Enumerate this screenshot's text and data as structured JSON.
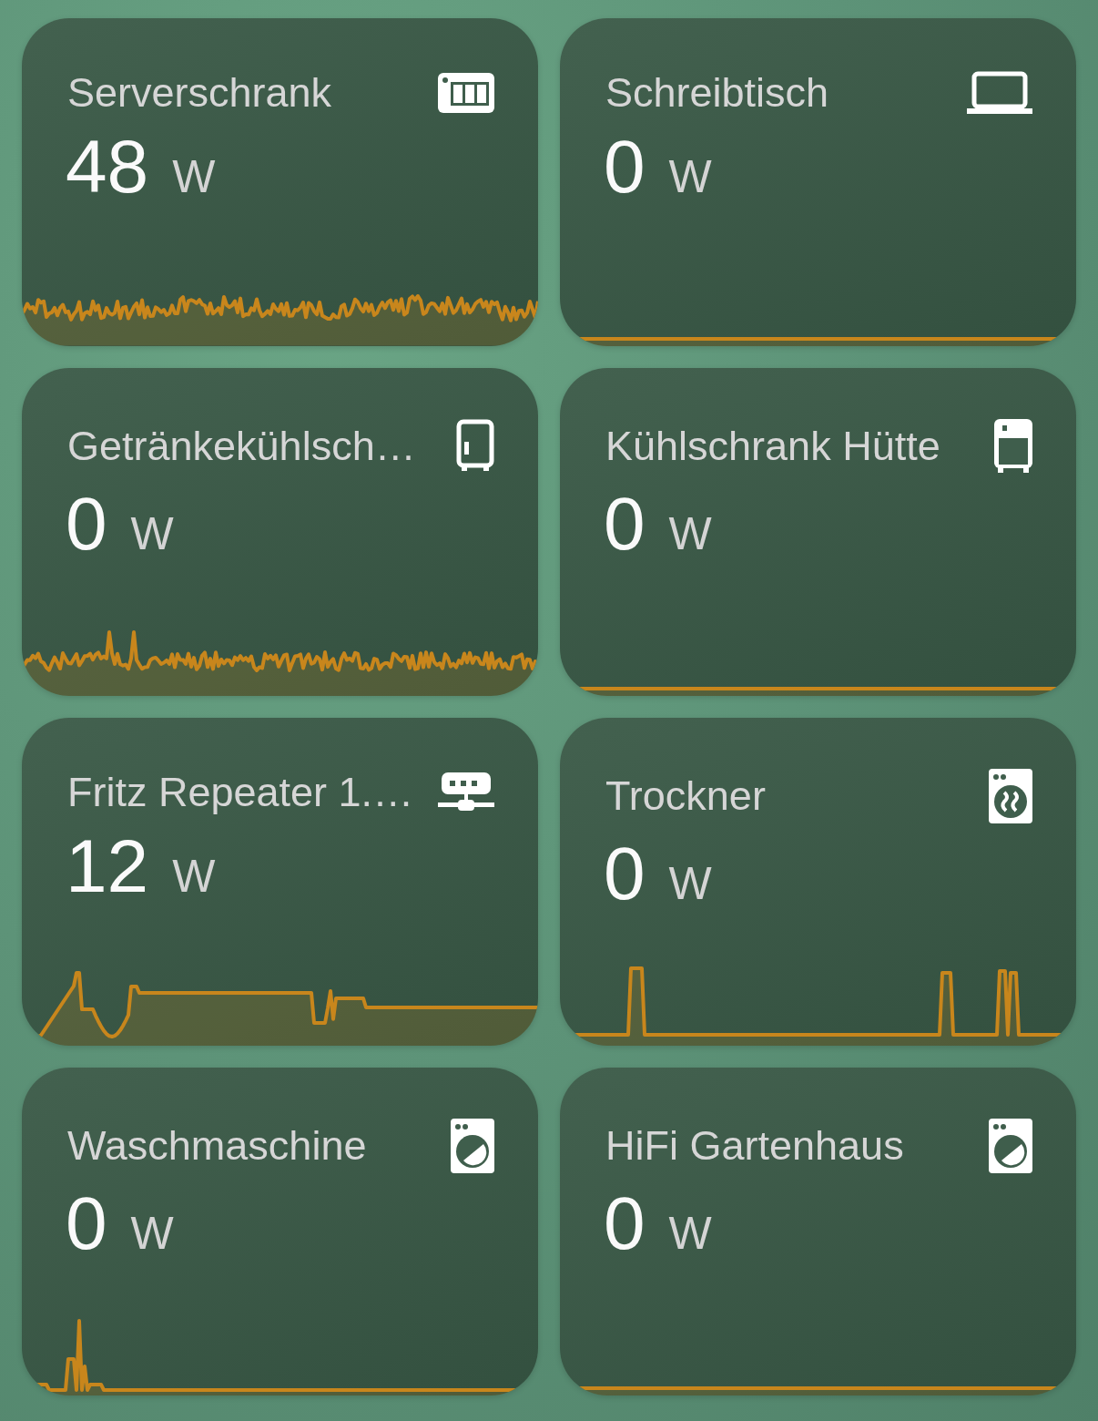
{
  "cards": [
    {
      "title": "Serverschrank",
      "value": "48",
      "unit": "W"
    },
    {
      "title": "Schreibtisch",
      "value": "0",
      "unit": "W"
    },
    {
      "title": "Getränkekühlsch…",
      "value": "0",
      "unit": "W"
    },
    {
      "title": "Kühlschrank Hütte",
      "value": "0",
      "unit": "W"
    },
    {
      "title": "Fritz Repeater 1.…",
      "value": "12",
      "unit": "W"
    },
    {
      "title": "Trockner",
      "value": "0",
      "unit": "W"
    },
    {
      "title": "Waschmaschine",
      "value": "0",
      "unit": "W"
    },
    {
      "title": "HiFi Gartenhaus",
      "value": "0",
      "unit": "W"
    }
  ]
}
